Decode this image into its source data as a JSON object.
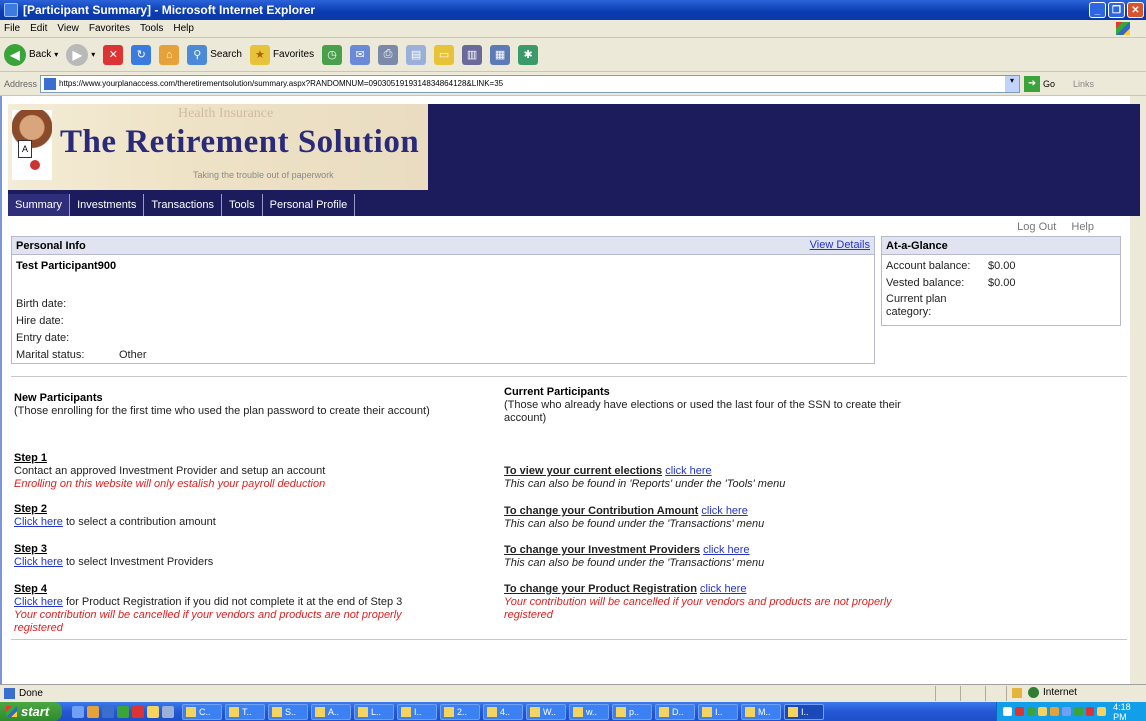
{
  "window": {
    "title": "[Participant Summary] - Microsoft Internet Explorer"
  },
  "menubar": [
    "File",
    "Edit",
    "View",
    "Favorites",
    "Tools",
    "Help"
  ],
  "toolbar": {
    "back": "Back",
    "search": "Search",
    "favorites": "Favorites"
  },
  "address": {
    "label": "Address",
    "url": "https://www.yourplanaccess.com/theretirementsolution/summary.aspx?RANDOMNUM=0903051919314834864128&LINK=35",
    "go": "Go",
    "links": "Links"
  },
  "banner": {
    "ghost_text": "Health Insurance",
    "title": "The Retirement Solution",
    "tagline": "Taking the trouble out of paperwork",
    "badge": "A"
  },
  "nav": [
    "Summary",
    "Investments",
    "Transactions",
    "Tools",
    "Personal Profile"
  ],
  "toplinks": {
    "logout": "Log Out",
    "help": "Help"
  },
  "personal": {
    "heading": "Personal Info",
    "view_details": "View Details",
    "name": "Test Participant900",
    "fields": [
      {
        "label": "Birth date:",
        "value": ""
      },
      {
        "label": "Hire date:",
        "value": ""
      },
      {
        "label": "Entry date:",
        "value": ""
      },
      {
        "label": "Marital status:",
        "value": "Other"
      }
    ]
  },
  "glance": {
    "heading": "At-a-Glance",
    "account_balance_label": "Account balance:",
    "account_balance": "$0.00",
    "vested_balance_label": "Vested balance:",
    "vested_balance": "$0.00",
    "category_label_1": "Current plan",
    "category_label_2": "category:"
  },
  "new_participants": {
    "title": "New Participants",
    "subtitle": "(Those enrolling for the first time who used the plan password to create their account)",
    "step1_head": "Step 1",
    "step1_text": "Contact an approved Investment Provider and setup an account",
    "step1_warn": "Enrolling on this website will only estalish your payroll deduction",
    "step2_head": "Step 2",
    "step2_link": "Click here",
    "step2_text": " to select a contribution amount",
    "step3_head": "Step 3",
    "step3_link": "Click here",
    "step3_text": " to select Investment Providers",
    "step4_head": "Step 4",
    "step4_link": "Click here",
    "step4_text": " for Product Registration if you did not complete it at the end of Step 3",
    "step4_warn_1": "Your contribution will be cancelled if your vendors and products are not properly",
    "step4_warn_2": "registered"
  },
  "current_participants": {
    "title": "Current Participants",
    "subtitle_1": "(Those who already have elections or used the last four of the SSN to create their",
    "subtitle_2": "account)",
    "elections_label": "To view your current elections",
    "elections_link": "click here",
    "elections_note": "This can also be found in 'Reports' under the 'Tools' menu",
    "contribution_label": "To change your Contribution Amount",
    "contribution_link": "click here",
    "contribution_note": "This can also be found under the 'Transactions' menu",
    "providers_label": "To change your Investment Providers",
    "providers_link": "click here",
    "providers_note": "This can also be found under the 'Transactions' menu",
    "registration_label": "To change your Product Registration",
    "registration_link": "click here",
    "registration_warn_1": "Your contribution will be cancelled if your vendors and products are not properly",
    "registration_warn_2": "registered"
  },
  "status": {
    "text": "Done",
    "zone": "Internet"
  },
  "taskbar": {
    "start": "start",
    "buttons": [
      "C..",
      "T..",
      "S..",
      "A..",
      "L..",
      "I..",
      "2..",
      "4..",
      "W..",
      "w..",
      "p..",
      "D..",
      "I..",
      "M..",
      "I.."
    ],
    "clock": "4:18 PM"
  },
  "colors": {
    "banner_bg": "#1c1c5c",
    "link": "#2233cc",
    "warning": "#e02020",
    "box_header": "#e0e3f0"
  }
}
